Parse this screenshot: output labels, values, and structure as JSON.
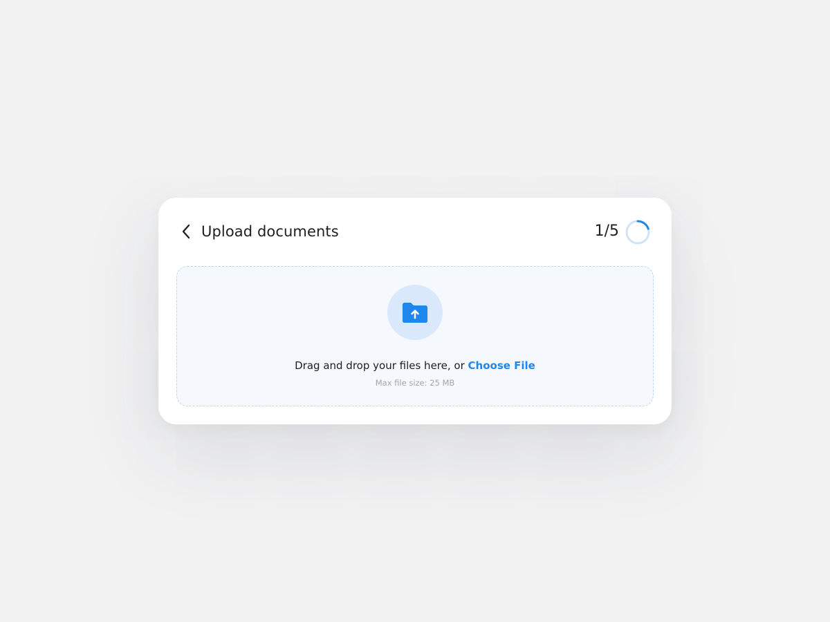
{
  "header": {
    "title": "Upload documents",
    "step_text": "1/5",
    "step_current": 1,
    "step_total": 5,
    "back_icon": "chevron-left-icon"
  },
  "dropzone": {
    "icon": "folder-upload-icon",
    "prompt": "Drag and drop your files here, or",
    "choose_label": "Choose File",
    "max_size": "Max file size: 25 MB"
  },
  "colors": {
    "accent": "#1f86ec",
    "icon_circle": "#d9e9fb",
    "ring_track": "#cfe3f8",
    "dropzone_bg": "#f5f8fc",
    "dropzone_border": "#b9d7f0",
    "page_bg": "#f2f2f3"
  }
}
